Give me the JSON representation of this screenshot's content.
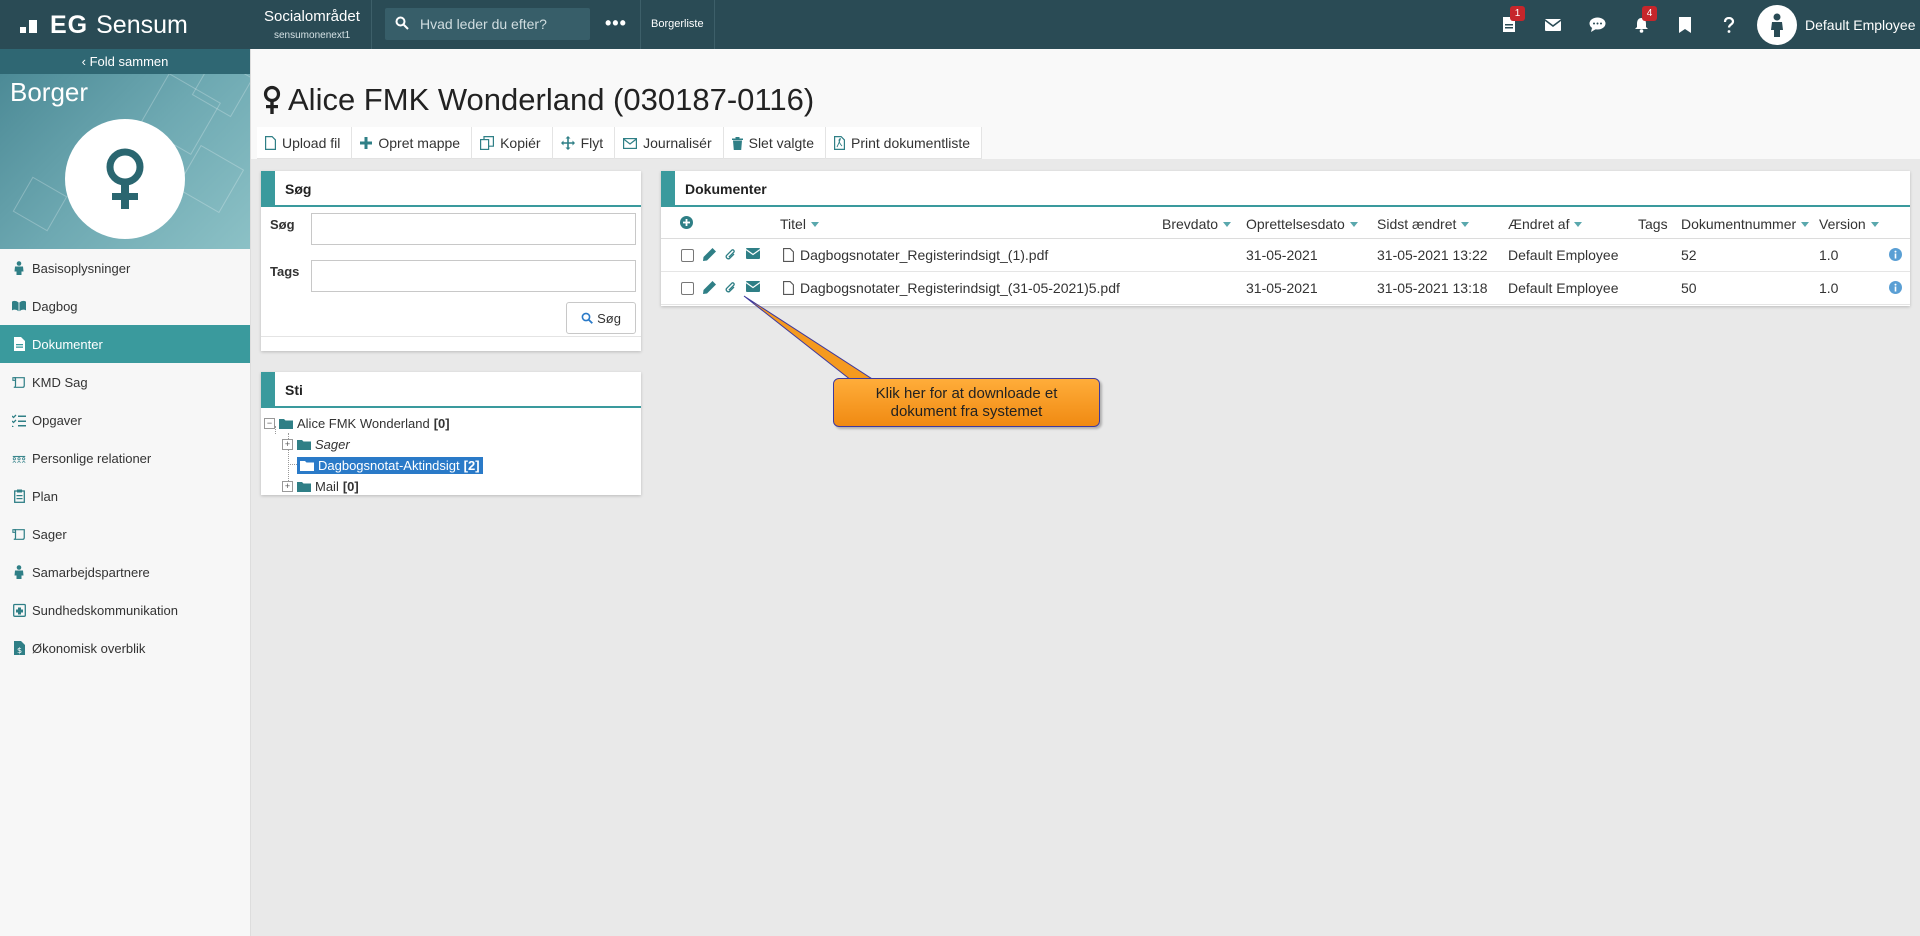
{
  "topbar": {
    "logo_eg": "EG",
    "logo_product": "Sensum",
    "org_name": "Socialområdet",
    "org_sub": "sensumonenext1",
    "search_placeholder": "Hvad leder du efter?",
    "more_label": "•••",
    "borgerliste": "Borgerliste",
    "icons": [
      {
        "name": "document-icon",
        "badge": "1"
      },
      {
        "name": "mail-icon",
        "badge": ""
      },
      {
        "name": "chat-icon",
        "badge": ""
      },
      {
        "name": "bell-icon",
        "badge": "4"
      },
      {
        "name": "bookmark-icon",
        "badge": ""
      },
      {
        "name": "help-icon",
        "badge": ""
      }
    ],
    "user_name": "Default Employee",
    "bar_color": "#2a4b55",
    "badge_color": "#c6262b"
  },
  "sidebar": {
    "fold_label": "Fold sammen",
    "hero_title": "Borger",
    "active_color": "#3a9a9d",
    "items": [
      {
        "label": "Basisoplysninger",
        "icon": "person-icon",
        "active": false
      },
      {
        "label": "Dagbog",
        "icon": "book-icon",
        "active": false
      },
      {
        "label": "Dokumenter",
        "icon": "document-icon",
        "active": true
      },
      {
        "label": "KMD Sag",
        "icon": "scroll-icon",
        "active": false
      },
      {
        "label": "Opgaver",
        "icon": "tasks-icon",
        "active": false
      },
      {
        "label": "Personlige relationer",
        "icon": "people-icon",
        "active": false
      },
      {
        "label": "Plan",
        "icon": "clipboard-icon",
        "active": false
      },
      {
        "label": "Sager",
        "icon": "scroll-icon",
        "active": false
      },
      {
        "label": "Samarbejdspartnere",
        "icon": "person-icon",
        "active": false
      },
      {
        "label": "Sundhedskommunikation",
        "icon": "health-icon",
        "active": false
      },
      {
        "label": "Økonomisk overblik",
        "icon": "money-icon",
        "active": false
      }
    ]
  },
  "main": {
    "title": "Alice FMK Wonderland (030187-0116)",
    "toolbar": [
      {
        "label": "Upload fil",
        "icon": "file-icon"
      },
      {
        "label": "Opret mappe",
        "icon": "plus-icon"
      },
      {
        "label": "Kopiér",
        "icon": "copy-icon"
      },
      {
        "label": "Flyt",
        "icon": "move-icon"
      },
      {
        "label": "Journalisér",
        "icon": "envelope-icon"
      },
      {
        "label": "Slet valgte",
        "icon": "trash-icon"
      },
      {
        "label": "Print dokumentliste",
        "icon": "pdf-icon"
      }
    ]
  },
  "search_panel": {
    "title": "Søg",
    "search_label": "Søg",
    "search_value": "",
    "tags_label": "Tags",
    "tags_value": "",
    "button_label": "Søg"
  },
  "tree_panel": {
    "title": "Sti",
    "root": {
      "label": "Alice FMK Wonderland",
      "count": "[0]"
    },
    "children": [
      {
        "label": "Sager",
        "count": "",
        "italic": true,
        "expandable": true,
        "selected": false
      },
      {
        "label": "Dagbogsnotat-Aktindsigt",
        "count": "[2]",
        "italic": false,
        "expandable": false,
        "selected": true
      },
      {
        "label": "Mail",
        "count": "[0]",
        "italic": false,
        "expandable": true,
        "selected": false
      }
    ]
  },
  "docs_panel": {
    "title": "Dokumenter",
    "columns": [
      "Titel",
      "Brevdato",
      "Oprettelsesdato",
      "Sidst ændret",
      "Ændret af",
      "Tags",
      "Dokumentnummer",
      "Version"
    ],
    "rows": [
      {
        "title": "Dagbogsnotater_Registerindsigt_(1).pdf",
        "brevdato": "",
        "oprettet": "31-05-2021",
        "aendret": "31-05-2021 13:22",
        "aendret_af": "Default Employee",
        "tags": "",
        "nummer": "52",
        "version": "1.0"
      },
      {
        "title": "Dagbogsnotater_Registerindsigt_(31-05-2021)5.pdf",
        "brevdato": "",
        "oprettet": "31-05-2021",
        "aendret": "31-05-2021 13:18",
        "aendret_af": "Default Employee",
        "tags": "",
        "nummer": "50",
        "version": "1.0"
      }
    ]
  },
  "callout": {
    "text": "Klik her for at downloade et dokument fra systemet",
    "color": "#f59a1f"
  }
}
